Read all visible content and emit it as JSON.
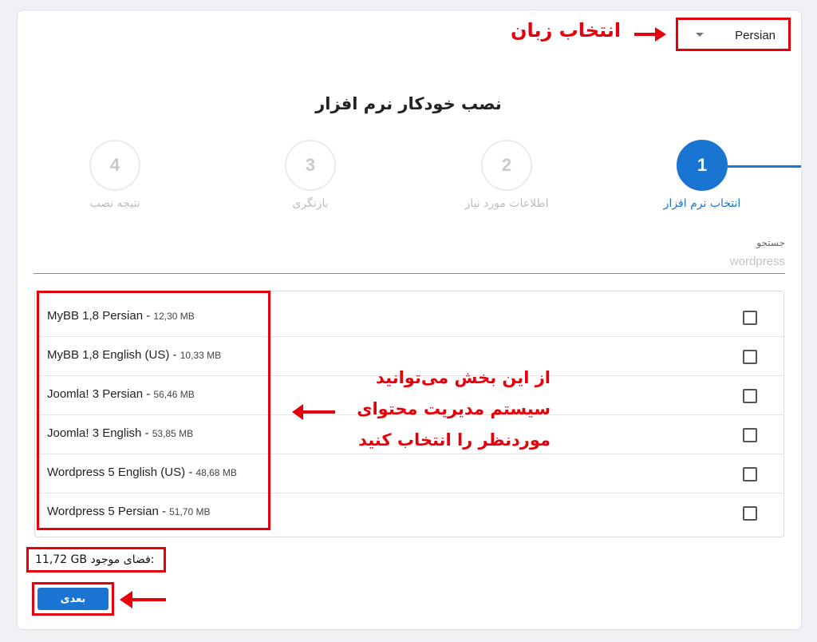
{
  "language_select": {
    "value": "Persian"
  },
  "annotations": {
    "language": "انتخاب زبان",
    "content_line1": "از این بخش می‌توانید",
    "content_line2": "سیستم مدیریت محتوای",
    "content_line3": "موردنظر را انتخاب کنید"
  },
  "page_title": "نصب خودکار نرم افزار",
  "steps": [
    {
      "number": "1",
      "label": "انتخاب نرم افزار",
      "active": true
    },
    {
      "number": "2",
      "label": "اطلاعات مورد نیاز",
      "active": false
    },
    {
      "number": "3",
      "label": "بازنگری",
      "active": false
    },
    {
      "number": "4",
      "label": "نتیجه نصب",
      "active": false
    }
  ],
  "search": {
    "label": "جستجو",
    "placeholder": "wordpress"
  },
  "software_list": [
    {
      "name": "MyBB 1,8 Persian - ",
      "size": "12,30 MB",
      "checked": false
    },
    {
      "name": "MyBB 1,8 English (US) - ",
      "size": "10,33 MB",
      "checked": false
    },
    {
      "name": "Joomla! 3 Persian - ",
      "size": "56,46 MB",
      "checked": false
    },
    {
      "name": "Joomla! 3 English - ",
      "size": "53,85 MB",
      "checked": false
    },
    {
      "name": "Wordpress 5 English (US) - ",
      "size": "48,68 MB",
      "checked": false
    },
    {
      "name": "Wordpress 5 Persian - ",
      "size": "51,70 MB",
      "checked": false
    }
  ],
  "free_space": {
    "label": "فضای موجود:",
    "value": "11,72 GB"
  },
  "next_button": "بعدی",
  "colors": {
    "accent": "#1a75d2",
    "annotation": "#e5000b"
  }
}
